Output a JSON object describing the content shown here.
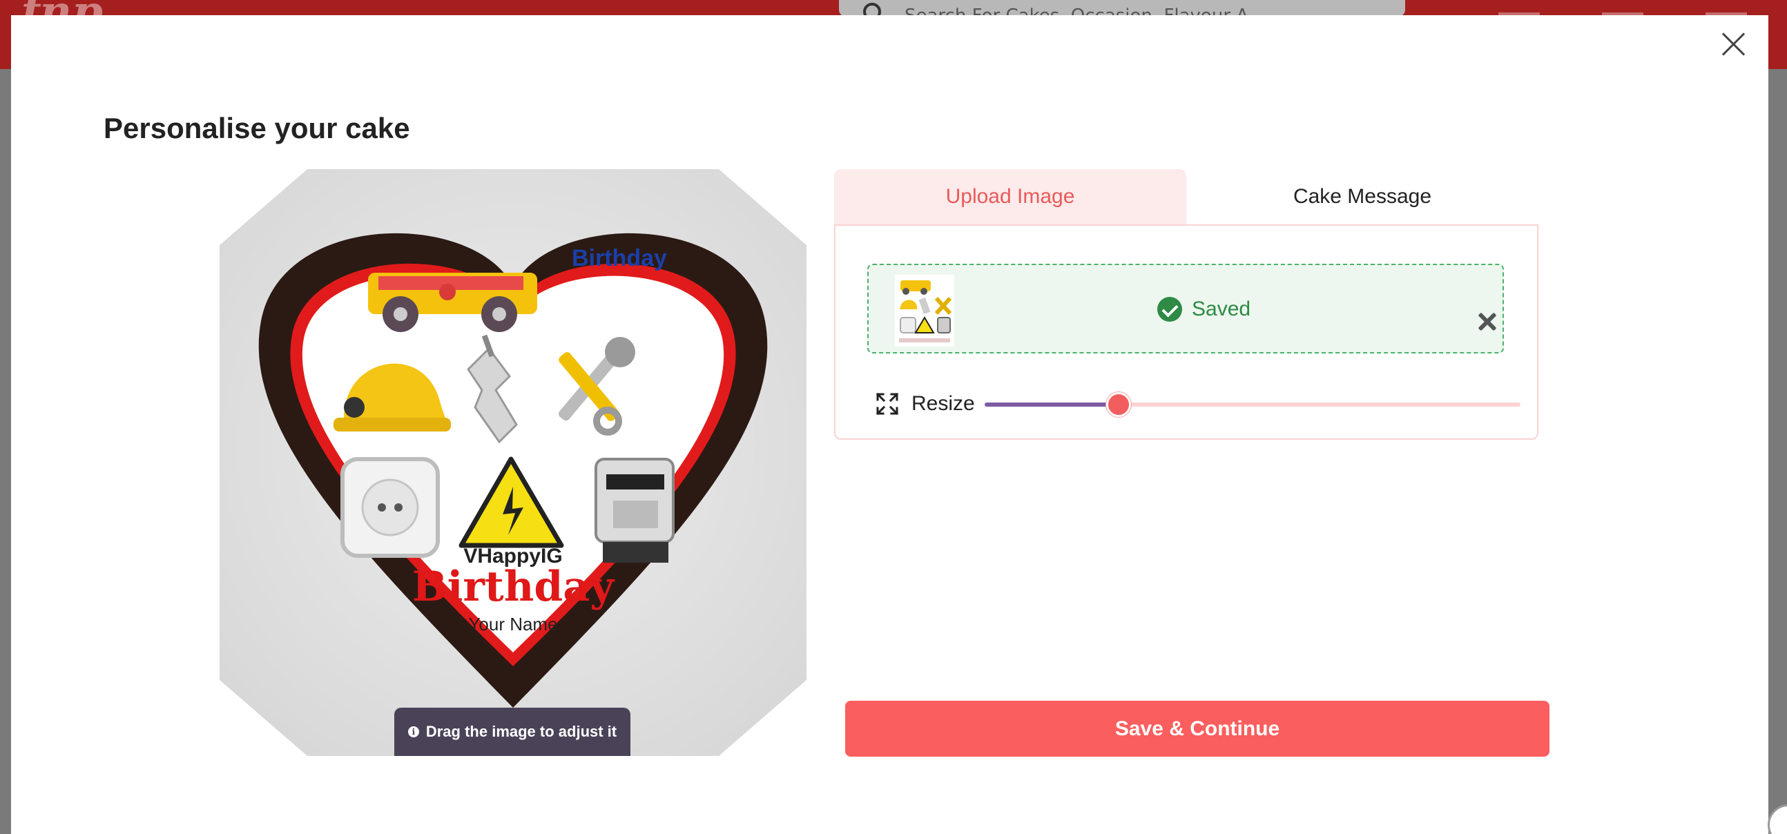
{
  "background": {
    "logo_text": "fnp",
    "search_placeholder": "Search For Cakes, Occasion, Flavour And More..."
  },
  "modal": {
    "title": "Personalise your cake",
    "close_icon": "close-icon"
  },
  "preview": {
    "cake_texts": {
      "happy": "VHappyIG",
      "birthday": "Birthday",
      "name": "Your Name"
    },
    "drag_hint": "Drag the image to adjust it",
    "hint_icon": "info-icon"
  },
  "tabs": [
    {
      "label": "Upload Image",
      "active": true
    },
    {
      "label": "Cake Message",
      "active": false
    }
  ],
  "upload": {
    "status_text": "Saved",
    "status_icon": "check-circle-icon",
    "remove_icon": "close-x-icon"
  },
  "resize": {
    "label": "Resize",
    "icon": "expand-icon",
    "value_fraction": 0.25
  },
  "actions": {
    "save_label": "Save & Continue"
  },
  "colors": {
    "accent": "#fb5e5e",
    "tab_active_bg": "#fdeaea",
    "success": "#2e8a44",
    "slider_fill": "#7e5aa3"
  }
}
